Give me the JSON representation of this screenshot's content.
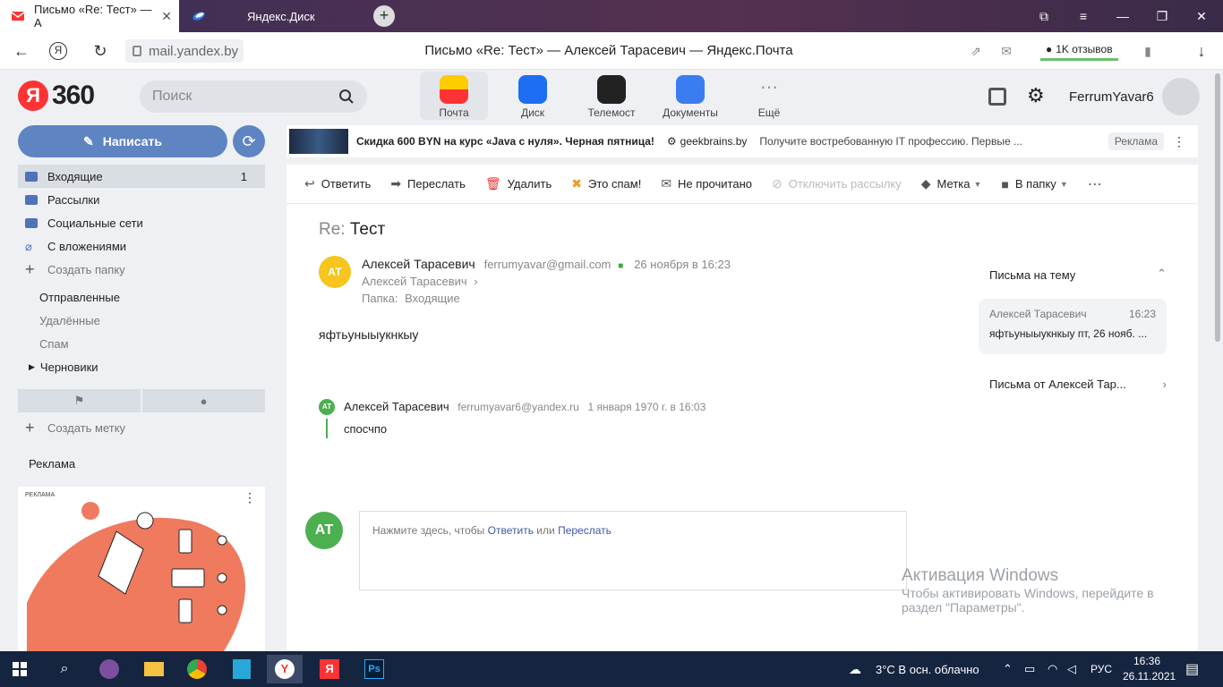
{
  "browser": {
    "tabs": [
      {
        "title": "Письмо «Re: Тест» — А"
      },
      {
        "title": "Яндекс.Диск"
      }
    ],
    "url": "mail.yandex.by",
    "page_title": "Письмо «Re: Тест» — Алексей Тарасевич — Яндекс.Почта",
    "reviews": "1K отзывов",
    "ya_button": "Я"
  },
  "header": {
    "logo_mark": "Я",
    "logo_text": "360",
    "search_placeholder": "Поиск",
    "services": [
      {
        "label": "Почта"
      },
      {
        "label": "Диск"
      },
      {
        "label": "Телемост"
      },
      {
        "label": "Документы"
      },
      {
        "label": "Ещё"
      }
    ],
    "username": "FerrumYavar6"
  },
  "sidebar": {
    "compose": "Написать",
    "folders": [
      {
        "label": "Входящие",
        "count": "1"
      },
      {
        "label": "Рассылки"
      },
      {
        "label": "Социальные сети"
      },
      {
        "label": "С вложениями"
      }
    ],
    "create_folder": "Создать папку",
    "subfolders": [
      "Отправленные",
      "Удалённые",
      "Спам",
      "Черновики"
    ],
    "create_label": "Создать метку",
    "ad_heading": "Реклама",
    "ad_tag": "РЕКЛАМА"
  },
  "ad_banner": {
    "title": "Скидка 600 BYN на курс «Java с нуля». Черная пятница!",
    "source": "geekbrains.by",
    "description": "Получите востребованную IT профессию. Первые ...",
    "mark": "Реклама"
  },
  "toolbar": {
    "reply": "Ответить",
    "forward": "Переслать",
    "delete": "Удалить",
    "spam": "Это спам!",
    "unread": "Не прочитано",
    "unsubscribe": "Отключить рассылку",
    "label": "Метка",
    "move": "В папку"
  },
  "message": {
    "subject_prefix": "Re:",
    "subject": "Тест",
    "avatar": "АТ",
    "from_name": "Алексей Тарасевич",
    "from_email": "ferrumyavar@gmail.com",
    "date": "26 ноября в 16:23",
    "to_name": "Алексей Тарасевич",
    "folder_label": "Папка:",
    "folder": "Входящие",
    "body": "яфтьуныыукнкыу",
    "quoted": {
      "avatar": "АТ",
      "from_name": "Алексей Тарасевич",
      "from_email": "ferrumyavar6@yandex.ru",
      "date": "1 января 1970 г. в 16:03",
      "body": "спосчпо"
    },
    "reply_avatar": "АТ",
    "reply_prompt": "Нажмите здесь, чтобы",
    "reply_link": "Ответить",
    "reply_or": "или",
    "forward_link": "Переслать"
  },
  "thread": {
    "title": "Письма на тему",
    "item_name": "Алексей Тарасевич",
    "item_time": "16:23",
    "item_snippet": "яфтьуныыукнкыу пт, 26 нояб. ...",
    "from_link": "Письма от Алексей Тар..."
  },
  "windows": {
    "activation_title": "Активация Windows",
    "activation_text1": "Чтобы активировать Windows, перейдите в",
    "activation_text2": "раздел \"Параметры\".",
    "weather": "3°C  В осн. облачно",
    "lang": "РУС",
    "time": "16:36",
    "date": "26.11.2021"
  }
}
